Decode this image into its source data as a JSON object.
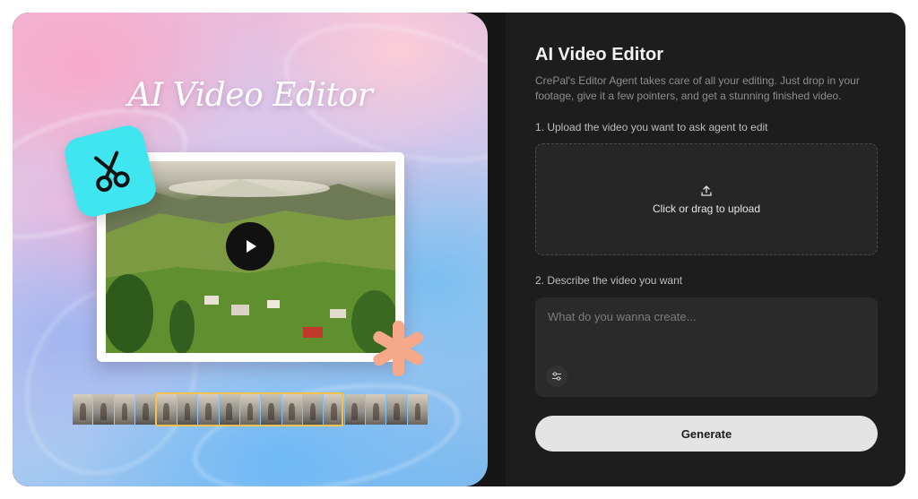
{
  "hero": {
    "title": "AI Video Editor"
  },
  "panel": {
    "title": "AI Video Editor",
    "description": "CrePal's Editor Agent takes care of all your editing. Just drop in your footage, give it a few pointers, and get a stunning finished video.",
    "step1_label": "1. Upload the video you want to ask agent to edit",
    "upload_text": "Click or drag to upload",
    "step2_label": "2. Describe the video you want",
    "prompt_placeholder": "What do you wanna create...",
    "prompt_value": "",
    "generate_label": "Generate"
  },
  "icons": {
    "scissors": "scissors-icon",
    "play": "play-icon",
    "upload": "upload-icon",
    "settings": "sliders-icon",
    "decoration": "asterisk-sparkle-icon"
  },
  "colors": {
    "badge": "#3fe6f0",
    "accent_sparkle": "#f6a98a",
    "filmstrip_selection": "#f2c14e",
    "panel_bg": "#1d1d1d",
    "button_bg": "#e4e4e4"
  }
}
